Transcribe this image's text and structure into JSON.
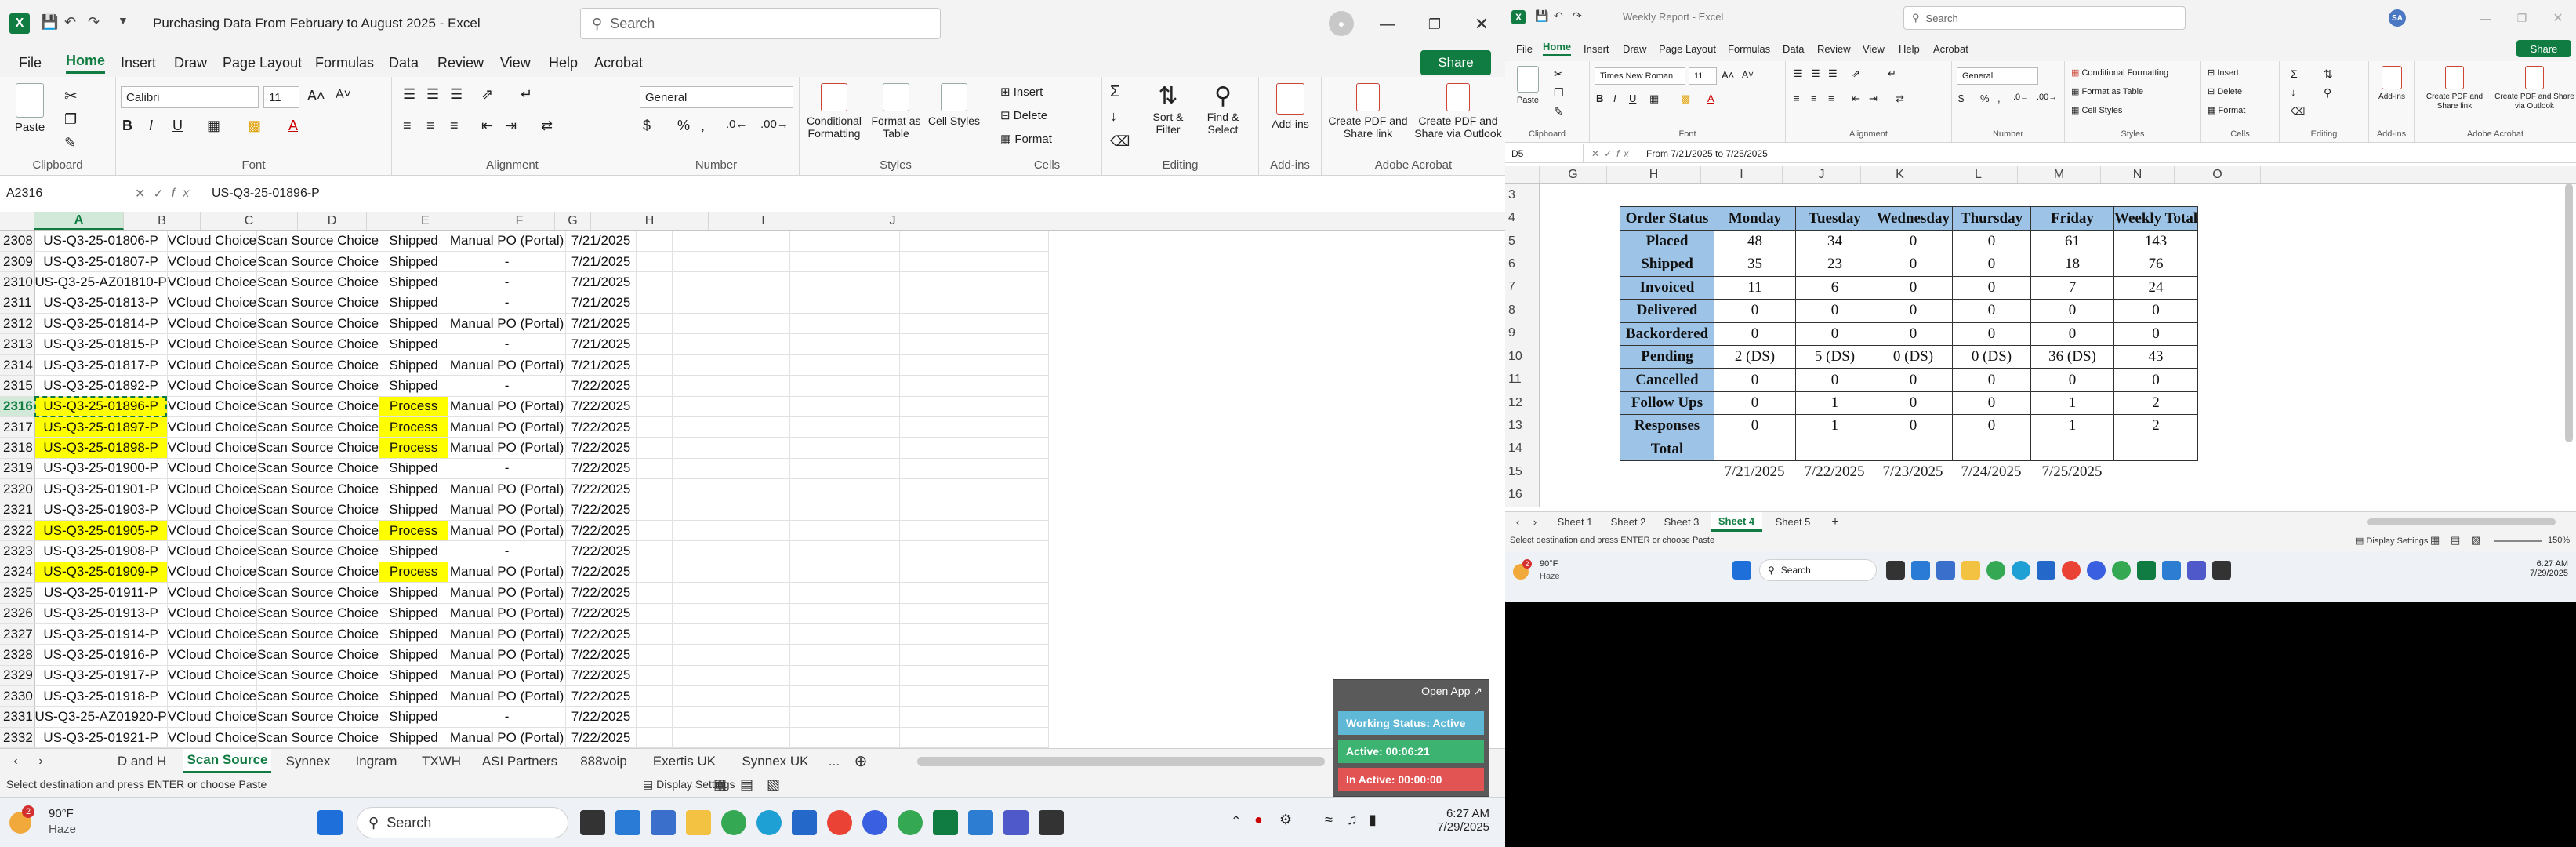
{
  "left": {
    "title": "Purchasing Data From February to August 2025  -  Excel",
    "search_placeholder": "Search",
    "menu": [
      "File",
      "Home",
      "Insert",
      "Draw",
      "Page Layout",
      "Formulas",
      "Data",
      "Review",
      "View",
      "Help",
      "Acrobat"
    ],
    "share": "Share",
    "ribbon": {
      "paste": "Paste",
      "clipboard": "Clipboard",
      "font_name": "Calibri",
      "font_size": "11",
      "font": "Font",
      "alignment": "Alignment",
      "number_format": "General",
      "number": "Number",
      "cond_fmt": "Conditional Formatting",
      "fmt_table": "Format as Table",
      "cell_styles": "Cell Styles",
      "styles": "Styles",
      "insert": "Insert",
      "delete": "Delete",
      "format": "Format",
      "cells": "Cells",
      "sort_filter": "Sort & Filter",
      "find_select": "Find & Select",
      "editing": "Editing",
      "addins": "Add-ins",
      "addins_grp": "Add-ins",
      "create_pdf_link": "Create PDF and Share link",
      "create_pdf_outlook": "Create PDF and Share via Outlook",
      "acrobat": "Adobe Acrobat"
    },
    "namebox": "A2316",
    "formula": "US-Q3-25-01896-P",
    "columns": [
      "A",
      "B",
      "C",
      "D",
      "E",
      "F",
      "G",
      "H",
      "I",
      "J"
    ],
    "rows": [
      {
        "n": "2308",
        "a": "US-Q3-25-01806-P",
        "b": "VCloud Choice",
        "c": "Scan Source Choice",
        "d": "Shipped",
        "e": "Manual PO (Portal)",
        "f": "7/21/2025"
      },
      {
        "n": "2309",
        "a": "US-Q3-25-01807-P",
        "b": "VCloud Choice",
        "c": "Scan Source Choice",
        "d": "Shipped",
        "e": "-",
        "f": "7/21/2025"
      },
      {
        "n": "2310",
        "a": "US-Q3-25-AZ01810-P",
        "b": "VCloud Choice",
        "c": "Scan Source Choice",
        "d": "Shipped",
        "e": "-",
        "f": "7/21/2025"
      },
      {
        "n": "2311",
        "a": "US-Q3-25-01813-P",
        "b": "VCloud Choice",
        "c": "Scan Source Choice",
        "d": "Shipped",
        "e": "-",
        "f": "7/21/2025"
      },
      {
        "n": "2312",
        "a": "US-Q3-25-01814-P",
        "b": "VCloud Choice",
        "c": "Scan Source Choice",
        "d": "Shipped",
        "e": "Manual PO (Portal)",
        "f": "7/21/2025"
      },
      {
        "n": "2313",
        "a": "US-Q3-25-01815-P",
        "b": "VCloud Choice",
        "c": "Scan Source Choice",
        "d": "Shipped",
        "e": "-",
        "f": "7/21/2025"
      },
      {
        "n": "2314",
        "a": "US-Q3-25-01817-P",
        "b": "VCloud Choice",
        "c": "Scan Source Choice",
        "d": "Shipped",
        "e": "Manual PO (Portal)",
        "f": "7/21/2025"
      },
      {
        "n": "2315",
        "a": "US-Q3-25-01892-P",
        "b": "VCloud Choice",
        "c": "Scan Source Choice",
        "d": "Shipped",
        "e": "-",
        "f": "7/22/2025"
      },
      {
        "n": "2316",
        "a": "US-Q3-25-01896-P",
        "b": "VCloud Choice",
        "c": "Scan Source Choice",
        "d": "Process",
        "e": "Manual PO (Portal)",
        "f": "7/22/2025",
        "hl": true,
        "sel": true
      },
      {
        "n": "2317",
        "a": "US-Q3-25-01897-P",
        "b": "VCloud Choice",
        "c": "Scan Source Choice",
        "d": "Process",
        "e": "Manual PO (Portal)",
        "f": "7/22/2025",
        "hl": true
      },
      {
        "n": "2318",
        "a": "US-Q3-25-01898-P",
        "b": "VCloud Choice",
        "c": "Scan Source Choice",
        "d": "Process",
        "e": "Manual PO (Portal)",
        "f": "7/22/2025",
        "hl": true
      },
      {
        "n": "2319",
        "a": "US-Q3-25-01900-P",
        "b": "VCloud Choice",
        "c": "Scan Source Choice",
        "d": "Shipped",
        "e": "-",
        "f": "7/22/2025"
      },
      {
        "n": "2320",
        "a": "US-Q3-25-01901-P",
        "b": "VCloud Choice",
        "c": "Scan Source Choice",
        "d": "Shipped",
        "e": "Manual PO (Portal)",
        "f": "7/22/2025"
      },
      {
        "n": "2321",
        "a": "US-Q3-25-01903-P",
        "b": "VCloud Choice",
        "c": "Scan Source Choice",
        "d": "Shipped",
        "e": "Manual PO (Portal)",
        "f": "7/22/2025"
      },
      {
        "n": "2322",
        "a": "US-Q3-25-01905-P",
        "b": "VCloud Choice",
        "c": "Scan Source Choice",
        "d": "Process",
        "e": "Manual PO (Portal)",
        "f": "7/22/2025",
        "hl": true
      },
      {
        "n": "2323",
        "a": "US-Q3-25-01908-P",
        "b": "VCloud Choice",
        "c": "Scan Source Choice",
        "d": "Shipped",
        "e": "-",
        "f": "7/22/2025"
      },
      {
        "n": "2324",
        "a": "US-Q3-25-01909-P",
        "b": "VCloud Choice",
        "c": "Scan Source Choice",
        "d": "Process",
        "e": "Manual PO (Portal)",
        "f": "7/22/2025",
        "hl": true
      },
      {
        "n": "2325",
        "a": "US-Q3-25-01911-P",
        "b": "VCloud Choice",
        "c": "Scan Source Choice",
        "d": "Shipped",
        "e": "Manual PO (Portal)",
        "f": "7/22/2025"
      },
      {
        "n": "2326",
        "a": "US-Q3-25-01913-P",
        "b": "VCloud Choice",
        "c": "Scan Source Choice",
        "d": "Shipped",
        "e": "Manual PO (Portal)",
        "f": "7/22/2025"
      },
      {
        "n": "2327",
        "a": "US-Q3-25-01914-P",
        "b": "VCloud Choice",
        "c": "Scan Source Choice",
        "d": "Shipped",
        "e": "Manual PO (Portal)",
        "f": "7/22/2025"
      },
      {
        "n": "2328",
        "a": "US-Q3-25-01916-P",
        "b": "VCloud Choice",
        "c": "Scan Source Choice",
        "d": "Shipped",
        "e": "Manual PO (Portal)",
        "f": "7/22/2025"
      },
      {
        "n": "2329",
        "a": "US-Q3-25-01917-P",
        "b": "VCloud Choice",
        "c": "Scan Source Choice",
        "d": "Shipped",
        "e": "Manual PO (Portal)",
        "f": "7/22/2025"
      },
      {
        "n": "2330",
        "a": "US-Q3-25-01918-P",
        "b": "VCloud Choice",
        "c": "Scan Source Choice",
        "d": "Shipped",
        "e": "Manual PO (Portal)",
        "f": "7/22/2025"
      },
      {
        "n": "2331",
        "a": "US-Q3-25-AZ01920-P",
        "b": "VCloud Choice",
        "c": "Scan Source Choice",
        "d": "Shipped",
        "e": "-",
        "f": "7/22/2025"
      },
      {
        "n": "2332",
        "a": "US-Q3-25-01921-P",
        "b": "VCloud Choice",
        "c": "Scan Source Choice",
        "d": "Shipped",
        "e": "Manual PO (Portal)",
        "f": "7/22/2025"
      }
    ],
    "tabs": [
      "D and H",
      "Scan Source",
      "Synnex",
      "Ingram",
      "TXWH",
      "ASI Partners",
      "888voip",
      "Exertis UK",
      "Synnex UK"
    ],
    "tabs_more": "...",
    "status": "Select destination and press ENTER or choose Paste",
    "display_settings": "Display Settings",
    "widget": {
      "open": "Open App ↗",
      "working": "Working Status: Active",
      "active": "Active: 00:06:21",
      "inactive": "In Active: 00:00:00"
    },
    "weather": {
      "temp": "90°F",
      "cond": "Haze",
      "badge": "2"
    },
    "search": "Search",
    "time": "6:27 AM",
    "date": "7/29/2025"
  },
  "right": {
    "title": "Weekly Report  -  Excel",
    "search_placeholder": "Search",
    "avatar": "SA",
    "menu": [
      "File",
      "Home",
      "Insert",
      "Draw",
      "Page Layout",
      "Formulas",
      "Data",
      "Review",
      "View",
      "Help",
      "Acrobat"
    ],
    "share": "Share",
    "ribbon": {
      "paste": "Paste",
      "clipboard": "Clipboard",
      "font_name": "Times New Roman",
      "font_size": "11",
      "font": "Font",
      "alignment": "Alignment",
      "number_format": "General",
      "number": "Number",
      "cond_fmt": "Conditional Formatting",
      "fmt_table": "Format as Table",
      "cell_styles": "Cell Styles",
      "styles": "Styles",
      "insert": "Insert",
      "delete": "Delete",
      "format": "Format",
      "cells": "Cells",
      "editing": "Editing",
      "addins": "Add-ins",
      "addins_grp": "Add-ins",
      "create_pdf_link": "Create PDF and Share link",
      "create_pdf_outlook": "Create PDF and Share via Outlook",
      "acrobat": "Adobe Acrobat"
    },
    "namebox": "D5",
    "formula": "From 7/21/2025 to 7/25/2025",
    "columns": [
      "G",
      "H",
      "I",
      "J",
      "K",
      "L",
      "M",
      "N",
      "O"
    ],
    "row_numbers": [
      "3",
      "4",
      "5",
      "6",
      "7",
      "8",
      "9",
      "10",
      "11",
      "12",
      "13",
      "14",
      "15",
      "16"
    ],
    "table_header": [
      "Order Status",
      "Monday",
      "Tuesday",
      "Wednesday",
      "Thursday",
      "Friday",
      "Weekly Total"
    ],
    "table_rows": [
      [
        "Placed",
        "48",
        "34",
        "0",
        "0",
        "61",
        "143"
      ],
      [
        "Shipped",
        "35",
        "23",
        "0",
        "0",
        "18",
        "76"
      ],
      [
        "Invoiced",
        "11",
        "6",
        "0",
        "0",
        "7",
        "24"
      ],
      [
        "Delivered",
        "0",
        "0",
        "0",
        "0",
        "0",
        "0"
      ],
      [
        "Backordered",
        "0",
        "0",
        "0",
        "0",
        "0",
        "0"
      ],
      [
        "Pending",
        "2 (DS)",
        "5 (DS)",
        "0 (DS)",
        "0 (DS)",
        "36 (DS)",
        "43"
      ],
      [
        "Cancelled",
        "0",
        "0",
        "0",
        "0",
        "0",
        "0"
      ],
      [
        "Follow Ups",
        "0",
        "1",
        "0",
        "0",
        "1",
        "2"
      ],
      [
        "Responses",
        "0",
        "1",
        "0",
        "0",
        "1",
        "2"
      ],
      [
        "Total",
        "",
        "",
        "",
        "",
        "",
        ""
      ]
    ],
    "dates": [
      "7/21/2025",
      "7/22/2025",
      "7/23/2025",
      "7/24/2025",
      "7/25/2025"
    ],
    "tabs": [
      "Sheet 1",
      "Sheet 2",
      "Sheet 3",
      "Sheet 4",
      "Sheet 5"
    ],
    "status": "Select destination and press ENTER or choose Paste",
    "display_settings": "Display Settings",
    "zoom": "150%",
    "weather": {
      "temp": "90°F",
      "cond": "Haze",
      "badge": "2"
    },
    "search": "Search",
    "time": "6:27 AM",
    "date": "7/29/2025"
  }
}
